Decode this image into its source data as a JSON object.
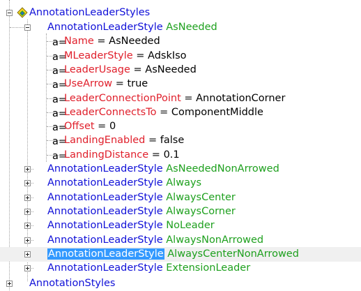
{
  "colors": {
    "element": "#1010d8",
    "value": "#1ea01e",
    "property": "#e0202c",
    "selection": "#3399ff"
  },
  "root": {
    "label": "AnnotationLeaderStyles",
    "expanded": true,
    "icon": "style-collection-icon"
  },
  "expanded_style": {
    "type": "AnnotationLeaderStyle",
    "name": "AsNeeded",
    "properties": [
      {
        "name": "Name",
        "sep": " = ",
        "value": "AsNeeded"
      },
      {
        "name": "MLeaderStyle",
        "sep": " = ",
        "value": "AdskIso"
      },
      {
        "name": "LeaderUsage",
        "sep": " = ",
        "value": "AsNeeded"
      },
      {
        "name": "UseArrow",
        "sep": " = ",
        "value": "true"
      },
      {
        "name": "LeaderConnectionPoint",
        "sep": " = ",
        "value": "AnnotationCorner"
      },
      {
        "name": "LeaderConnectsTo",
        "sep": " = ",
        "value": "ComponentMiddle"
      },
      {
        "name": "Offset",
        "sep": " = ",
        "value": "0"
      },
      {
        "name": "LandingEnabled",
        "sep": " = ",
        "value": "false"
      },
      {
        "name": "LandingDistance",
        "sep": " = ",
        "value": "0.1"
      }
    ]
  },
  "collapsed_styles": [
    {
      "type": "AnnotationLeaderStyle",
      "name": "AsNeededNonArrowed",
      "selected": false
    },
    {
      "type": "AnnotationLeaderStyle",
      "name": "Always",
      "selected": false
    },
    {
      "type": "AnnotationLeaderStyle",
      "name": "AlwaysCenter",
      "selected": false
    },
    {
      "type": "AnnotationLeaderStyle",
      "name": "AlwaysCorner",
      "selected": false
    },
    {
      "type": "AnnotationLeaderStyle",
      "name": "NoLeader",
      "selected": false
    },
    {
      "type": "AnnotationLeaderStyle",
      "name": "AlwaysNonArrowed",
      "selected": false
    },
    {
      "type": "AnnotationLeaderStyle",
      "name": "AlwaysCenterNonArrowed",
      "selected": true
    },
    {
      "type": "AnnotationLeaderStyle",
      "name": "ExtensionLeader",
      "selected": false
    }
  ],
  "next_node": {
    "label": "AnnotationStyles"
  }
}
